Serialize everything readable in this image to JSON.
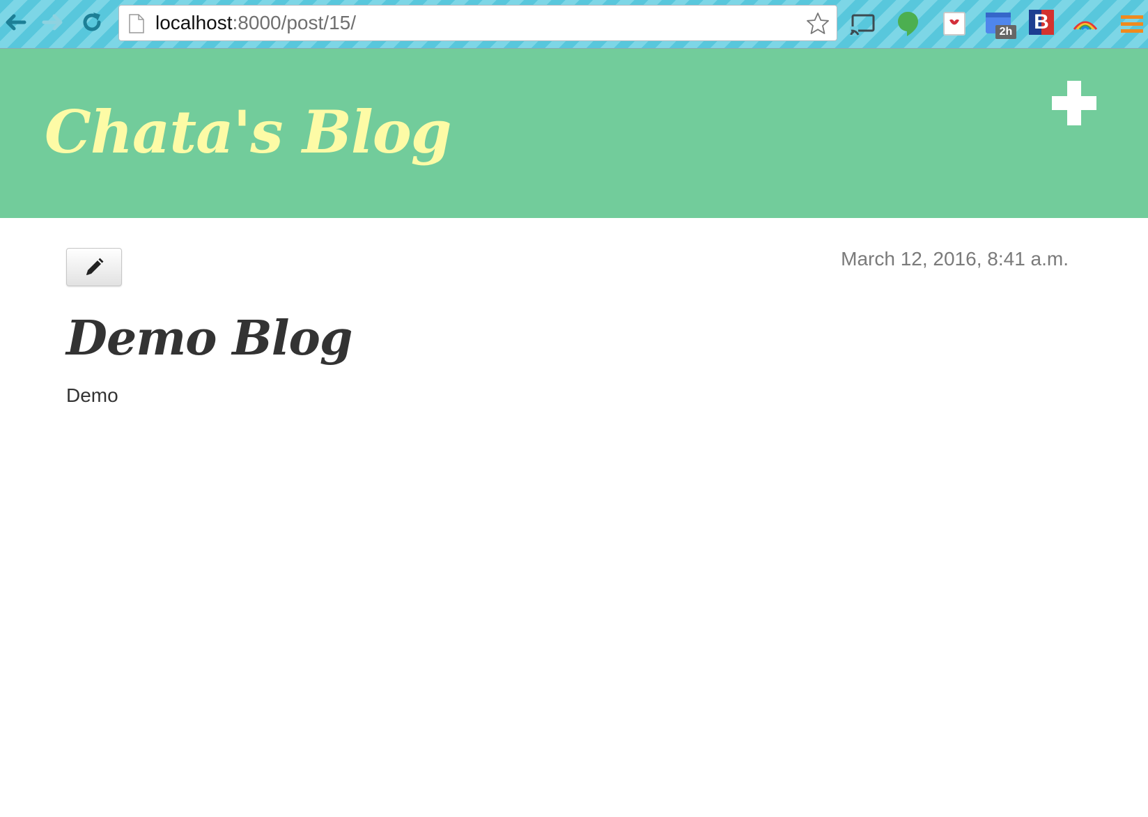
{
  "browser": {
    "url_host": "localhost",
    "url_rest": ":8000/post/15/",
    "icons": {
      "back": "arrow-left-icon",
      "forward": "arrow-right-icon",
      "reload": "reload-icon",
      "page": "page-icon",
      "bookmark": "star-icon",
      "extensions": [
        "cast-icon",
        "hangouts-icon",
        "pocket-icon",
        "calendar-icon",
        "b-extension-icon",
        "rainbow-icon",
        "menu-icon"
      ]
    },
    "extension_badge": "2h",
    "extension_letter": "B"
  },
  "blog": {
    "title": "Chata's Blog",
    "add_icon": "plus-icon"
  },
  "post": {
    "edit_icon": "pencil-icon",
    "date": "March 12, 2016, 8:41 a.m.",
    "title": "Demo Blog",
    "body": "Demo"
  },
  "colors": {
    "header_bg": "#72cc9b",
    "title_color": "#fdfba6",
    "text_color": "#333333",
    "date_color": "#7a7a7a",
    "toolbar_bg": "#58c7dc"
  }
}
